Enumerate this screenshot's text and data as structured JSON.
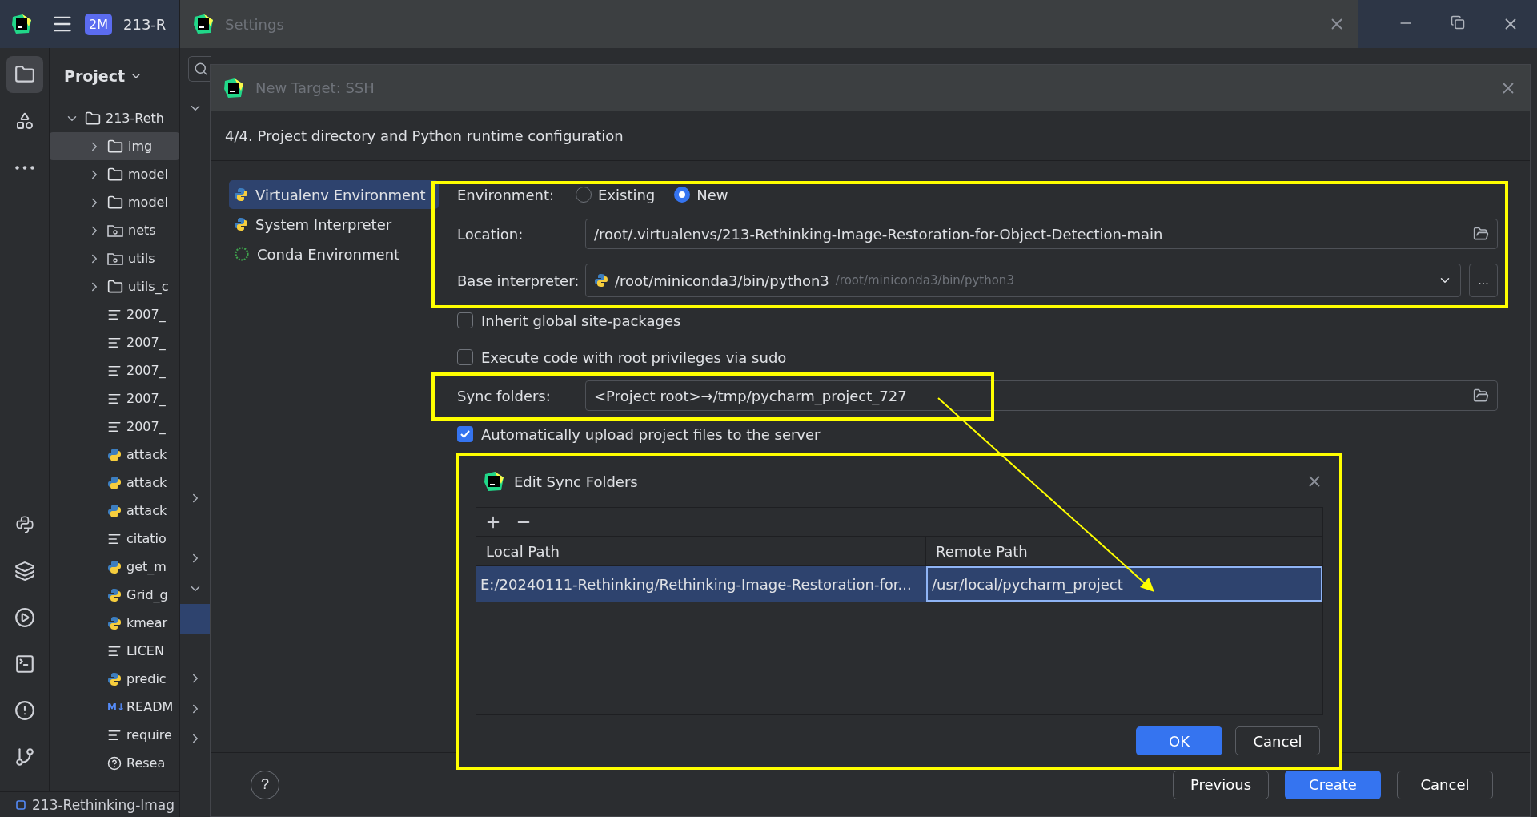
{
  "ide": {
    "badge": "2M",
    "project": "213-R",
    "panel_title": "Project",
    "top_tools": [
      {
        "kind": "project",
        "selected": true
      },
      {
        "kind": "structure",
        "selected": false
      },
      {
        "kind": "more",
        "selected": false
      }
    ],
    "bottom_tools": [
      {
        "kind": "python",
        "selected": false
      },
      {
        "kind": "layers",
        "selected": false
      },
      {
        "kind": "run",
        "selected": false
      },
      {
        "kind": "terminal",
        "selected": false
      },
      {
        "kind": "problems",
        "selected": false
      },
      {
        "kind": "git",
        "selected": false
      }
    ],
    "tree": [
      {
        "name": "213-Reth",
        "kind": "folder",
        "expanded": true,
        "selected": false,
        "children": [
          {
            "name": "img",
            "kind": "folder",
            "expanded": false,
            "selected": true
          },
          {
            "name": "model",
            "kind": "folder",
            "expanded": false,
            "selected": false
          },
          {
            "name": "model",
            "kind": "folder",
            "expanded": false,
            "selected": false
          },
          {
            "name": "nets",
            "kind": "module",
            "expanded": false,
            "selected": false
          },
          {
            "name": "utils",
            "kind": "module",
            "expanded": false,
            "selected": false
          },
          {
            "name": "utils_c",
            "kind": "folder",
            "expanded": false,
            "selected": false
          },
          {
            "name": "2007_",
            "kind": "text",
            "selected": false
          },
          {
            "name": "2007_",
            "kind": "text",
            "selected": false
          },
          {
            "name": "2007_",
            "kind": "text",
            "selected": false
          },
          {
            "name": "2007_",
            "kind": "text",
            "selected": false
          },
          {
            "name": "2007_",
            "kind": "text",
            "selected": false
          },
          {
            "name": "attack",
            "kind": "python",
            "selected": false
          },
          {
            "name": "attack",
            "kind": "python",
            "selected": false
          },
          {
            "name": "attack",
            "kind": "python",
            "selected": false
          },
          {
            "name": "citatio",
            "kind": "text",
            "selected": false
          },
          {
            "name": "get_m",
            "kind": "python",
            "selected": false
          },
          {
            "name": "Grid_g",
            "kind": "python",
            "selected": false
          },
          {
            "name": "kmear",
            "kind": "python",
            "selected": false
          },
          {
            "name": "LICEN",
            "kind": "text",
            "selected": false
          },
          {
            "name": "predic",
            "kind": "python",
            "selected": false
          },
          {
            "name": "READM",
            "kind": "markdown",
            "icon_text": "M↓",
            "selected": false
          },
          {
            "name": "require",
            "kind": "text",
            "selected": false
          },
          {
            "name": "Resea",
            "kind": "help",
            "selected": false
          }
        ]
      }
    ],
    "status_bar": "213-Rethinking-Imag"
  },
  "settings": {
    "title": "Settings",
    "rows": [
      {
        "kind": "toggle",
        "expanded": true,
        "selected": false
      },
      {
        "kind": "leaf"
      },
      {
        "kind": "leaf"
      },
      {
        "kind": "leaf"
      },
      {
        "kind": "leaf"
      },
      {
        "kind": "leaf"
      },
      {
        "kind": "leaf"
      },
      {
        "kind": "leaf"
      },
      {
        "kind": "leaf"
      },
      {
        "kind": "leaf"
      },
      {
        "kind": "leaf"
      },
      {
        "kind": "leaf"
      },
      {
        "kind": "leaf"
      },
      {
        "kind": "toggle",
        "expanded": false,
        "selected": false
      },
      {
        "kind": "leaf"
      },
      {
        "kind": "toggle",
        "expanded": false,
        "selected": false
      },
      {
        "kind": "toggle",
        "expanded": true,
        "selected": false
      },
      {
        "kind": "leaf",
        "selected": true
      },
      {
        "kind": "leaf"
      },
      {
        "kind": "toggle",
        "expanded": false,
        "selected": false
      },
      {
        "kind": "toggle",
        "expanded": false,
        "selected": false
      },
      {
        "kind": "toggle",
        "expanded": false,
        "selected": false
      }
    ]
  },
  "new_target": {
    "title": "New Target: SSH",
    "step": "4/4. Project directory and Python runtime configuration",
    "env_types": [
      {
        "label": "Virtualenv Environment",
        "kind": "virtualenv",
        "selected": true
      },
      {
        "label": "System Interpreter",
        "kind": "system",
        "selected": false
      },
      {
        "label": "Conda Environment",
        "kind": "conda",
        "selected": false
      }
    ],
    "environment": {
      "label": "Environment:",
      "options": [
        {
          "label": "Existing",
          "selected": false
        },
        {
          "label": "New",
          "selected": true
        }
      ]
    },
    "location": {
      "label": "Location:",
      "value": "/root/.virtualenvs/213-Rethinking-Image-Restoration-for-Object-Detection-main"
    },
    "base_interpreter": {
      "label": "Base interpreter:",
      "value": "/root/miniconda3/bin/python3",
      "hint": "/root/miniconda3/bin/python3",
      "browse": "..."
    },
    "checkboxes": [
      {
        "label": "Inherit global site-packages",
        "checked": false
      },
      {
        "label": "Execute code with root privileges via sudo",
        "checked": false
      }
    ],
    "sync_folders": {
      "label": "Sync folders:",
      "value": "<Project root>→/tmp/pycharm_project_727"
    },
    "auto_upload": {
      "label": "Automatically upload project files to the server",
      "checked": true
    },
    "help": "?",
    "buttons": [
      {
        "label": "Previous",
        "kind": "secondary"
      },
      {
        "label": "Create",
        "kind": "primary"
      },
      {
        "label": "Cancel",
        "kind": "secondary"
      }
    ]
  },
  "edit_sync": {
    "title": "Edit Sync Folders",
    "columns": [
      "Local Path",
      "Remote Path"
    ],
    "rows": [
      {
        "cells": [
          "E:/20240111-Rethinking/Rethinking-Image-Restoration-for...",
          "/usr/local/pycharm_project"
        ],
        "selected": true
      }
    ],
    "buttons": [
      {
        "label": "OK",
        "kind": "primary"
      },
      {
        "label": "Cancel",
        "kind": "secondary"
      }
    ]
  }
}
